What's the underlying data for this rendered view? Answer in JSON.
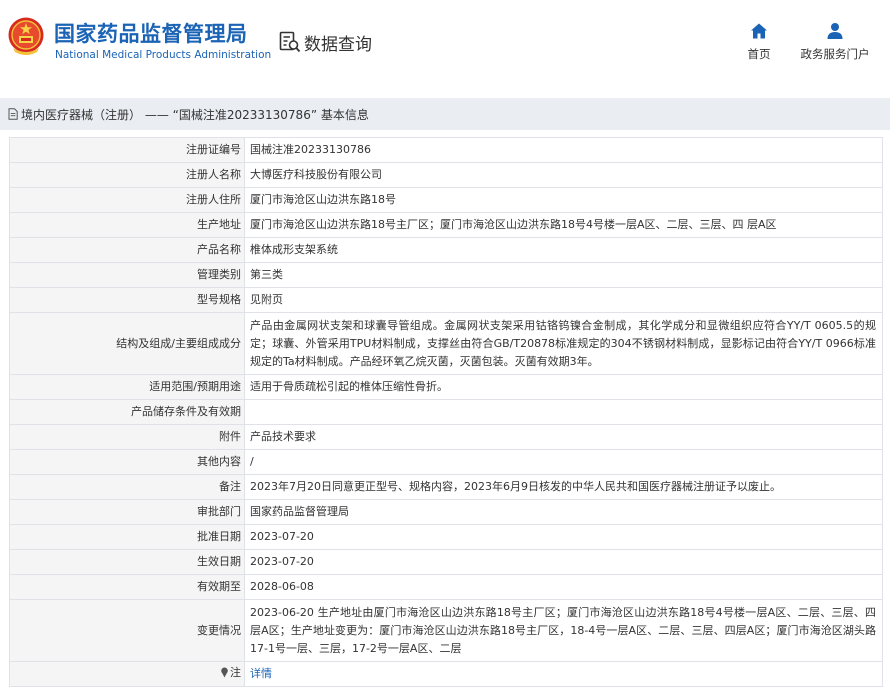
{
  "header": {
    "brand_cn": "国家药品监督管理局",
    "brand_en": "National Medical Products Administration",
    "query_label": "数据查询",
    "nav": [
      {
        "label": "首页",
        "icon": "home-icon"
      },
      {
        "label": "政务服务门户",
        "icon": "user-icon"
      }
    ]
  },
  "breadcrumb": {
    "icon": "document-icon",
    "text": "境内医疗器械（注册） —— “国械注准20233130786” 基本信息"
  },
  "details": [
    {
      "key": "注册证编号",
      "value": "国械注准20233130786"
    },
    {
      "key": "注册人名称",
      "value": "大博医疗科技股份有限公司"
    },
    {
      "key": "注册人住所",
      "value": "厦门市海沧区山边洪东路18号"
    },
    {
      "key": "生产地址",
      "value": "厦门市海沧区山边洪东路18号主厂区；厦门市海沧区山边洪东路18号4号楼一层A区、二层、三层、四 层A区"
    },
    {
      "key": "产品名称",
      "value": "椎体成形支架系统"
    },
    {
      "key": "管理类别",
      "value": "第三类"
    },
    {
      "key": "型号规格",
      "value": "见附页"
    },
    {
      "key": "结构及组成/主要组成成分",
      "value": "产品由金属网状支架和球囊导管组成。金属网状支架采用钴铬钨镍合金制成，其化学成分和显微组织应符合YY/T 0605.5的规定；球囊、外管采用TPU材料制成，支撑丝由符合GB/T20878标准规定的304不锈钢材料制成，显影标记由符合YY/T 0966标准规定的Ta材料制成。产品经环氧乙烷灭菌，灭菌包装。灭菌有效期3年。"
    },
    {
      "key": "适用范围/预期用途",
      "value": "适用于骨质疏松引起的椎体压缩性骨折。"
    },
    {
      "key": "产品储存条件及有效期",
      "value": ""
    },
    {
      "key": "附件",
      "value": "产品技术要求"
    },
    {
      "key": "其他内容",
      "value": "/"
    },
    {
      "key": "备注",
      "value": "2023年7月20日同意更正型号、规格内容，2023年6月9日核发的中华人民共和国医疗器械注册证予以废止。"
    },
    {
      "key": "审批部门",
      "value": "国家药品监督管理局"
    },
    {
      "key": "批准日期",
      "value": "2023-07-20"
    },
    {
      "key": "生效日期",
      "value": "2023-07-20"
    },
    {
      "key": "有效期至",
      "value": "2028-06-08"
    },
    {
      "key": "变更情况",
      "value": "2023-06-20 生产地址由厦门市海沧区山边洪东路18号主厂区；厦门市海沧区山边洪东路18号4号楼一层A区、二层、三层、四层A区；生产地址变更为：厦门市海沧区山边洪东路18号主厂区，18-4号一层A区、二层、三层、四层A区；厦门市海沧区湖头路17-1号一层、三层，17-2号一层A区、二层"
    }
  ],
  "note_row": {
    "key": "注",
    "icon": "pin-icon",
    "link": "详情"
  },
  "colors": {
    "brand": "#1b63b5",
    "crumb_bg": "#eaeef3",
    "key_bg": "#f5f5f5",
    "border": "#dfe3e8"
  }
}
